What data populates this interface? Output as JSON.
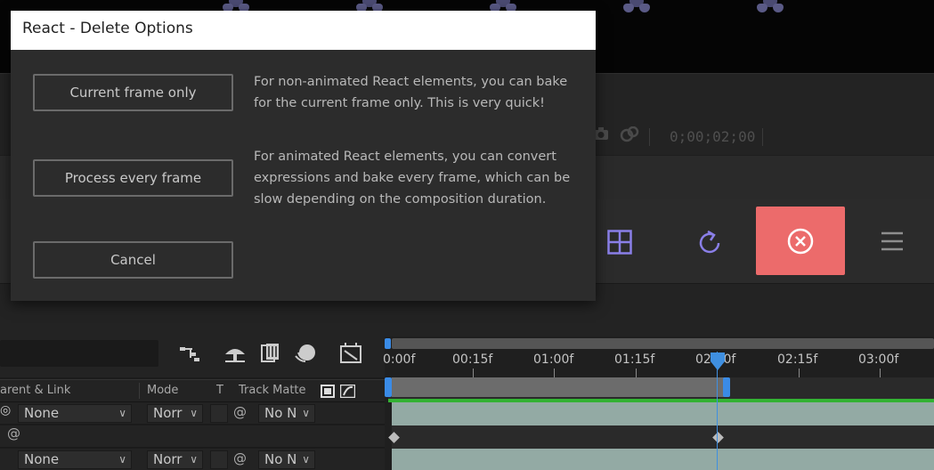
{
  "dialog": {
    "title": "React - Delete Options",
    "buttons": {
      "current_frame": "Current frame only",
      "every_frame": "Process every frame",
      "cancel": "Cancel"
    },
    "descriptions": {
      "current_frame": "For non-animated React elements, you can bake for the current frame only. This is very quick!",
      "every_frame": "For animated React elements, you can convert expressions and bake every frame, which can be slow depending on the composition duration."
    }
  },
  "viewer": {
    "timecode": "0;00;02;00"
  },
  "react_panel": {
    "icons": [
      "grid-icon",
      "refresh-icon",
      "delete-x-icon",
      "menu-icon"
    ],
    "accent_color": "#ec6b6b",
    "icon_color": "#8a7fe8"
  },
  "timeline": {
    "columns": {
      "parent": "arent & Link",
      "mode": "Mode",
      "t": "T",
      "track_matte": "Track Matte"
    },
    "rows": [
      {
        "parent": "None",
        "mode": "Norr",
        "matte": "No N"
      },
      {
        "parent": "",
        "mode": "",
        "matte": ""
      },
      {
        "parent": "None",
        "mode": "Norr",
        "matte": "No N"
      }
    ],
    "ruler": [
      "0:00f",
      "00:15f",
      "01:00f",
      "01:15f",
      "02:00f",
      "02:15f",
      "03:00f"
    ],
    "colors": {
      "label_green": "#33b233",
      "track_teal": "#93aaa4",
      "playhead_blue": "#3f8fe0"
    }
  }
}
